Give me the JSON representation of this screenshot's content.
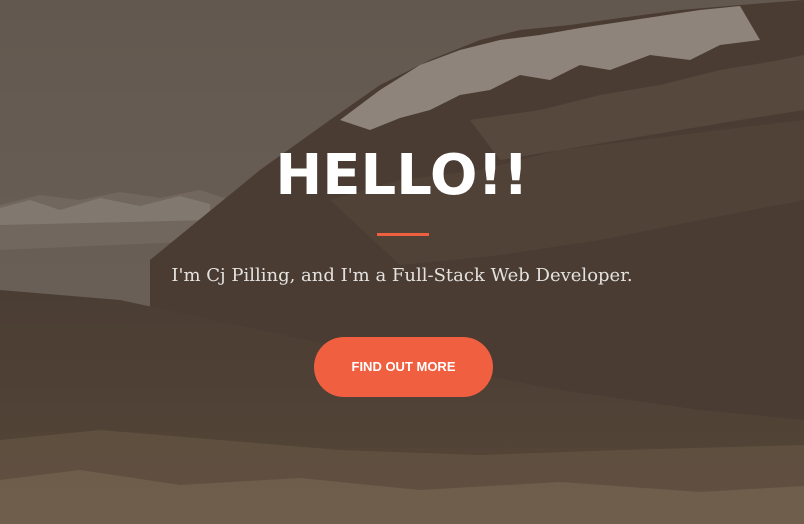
{
  "hero": {
    "title": "HELLO!!",
    "subtitle": "I'm Cj Pilling, and I'm a Full-Stack Web Developer.",
    "button_label": "FIND OUT MORE",
    "accent_color": "#f05f40",
    "text_color": "#ffffff"
  }
}
